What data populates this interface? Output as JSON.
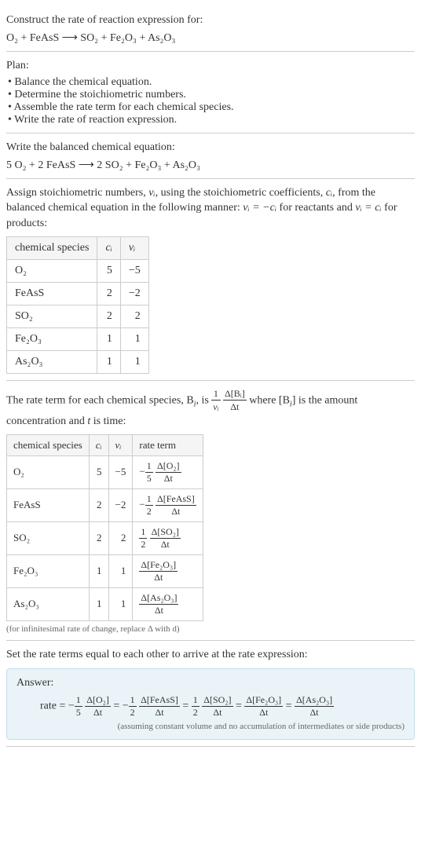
{
  "intro": {
    "title": "Construct the rate of reaction expression for:",
    "equation": "O₂ + FeAsS ⟶ SO₂ + Fe₂O₃ + As₂O₃"
  },
  "plan": {
    "heading": "Plan:",
    "items": [
      "Balance the chemical equation.",
      "Determine the stoichiometric numbers.",
      "Assemble the rate term for each chemical species.",
      "Write the rate of reaction expression."
    ]
  },
  "balanced": {
    "heading": "Write the balanced chemical equation:",
    "equation": "5 O₂ + 2 FeAsS ⟶ 2 SO₂ + Fe₂O₃ + As₂O₃"
  },
  "stoich": {
    "text_parts": {
      "p1": "Assign stoichiometric numbers, ",
      "nu_i": "νᵢ",
      "p2": ", using the stoichiometric coefficients, ",
      "c_i": "cᵢ",
      "p3": ", from the balanced chemical equation in the following manner: ",
      "eq1": "νᵢ = −cᵢ",
      "p4": " for reactants and ",
      "eq2": "νᵢ = cᵢ",
      "p5": " for products:"
    },
    "headers": {
      "species": "chemical species",
      "c": "cᵢ",
      "nu": "νᵢ"
    },
    "rows": [
      {
        "species": "O₂",
        "c": "5",
        "nu": "−5"
      },
      {
        "species": "FeAsS",
        "c": "2",
        "nu": "−2"
      },
      {
        "species": "SO₂",
        "c": "2",
        "nu": "2"
      },
      {
        "species": "Fe₂O₃",
        "c": "1",
        "nu": "1"
      },
      {
        "species": "As₂O₃",
        "c": "1",
        "nu": "1"
      }
    ]
  },
  "rate_term": {
    "text_parts": {
      "p1": "The rate term for each chemical species, B",
      "sub_i": "i",
      "p2": ", is ",
      "frac1_num": "1",
      "frac1_den": "νᵢ",
      "frac2_num": "Δ[Bᵢ]",
      "frac2_den": "Δt",
      "p3": " where [B",
      "p4": "] is the amount concentration and ",
      "t": "t",
      "p5": " is time:"
    },
    "headers": {
      "species": "chemical species",
      "c": "cᵢ",
      "nu": "νᵢ",
      "rate": "rate term"
    },
    "rows": [
      {
        "species": "O₂",
        "c": "5",
        "nu": "−5",
        "neg": "−",
        "fn1": "1",
        "fd1": "5",
        "fn2": "Δ[O₂]",
        "fd2": "Δt"
      },
      {
        "species": "FeAsS",
        "c": "2",
        "nu": "−2",
        "neg": "−",
        "fn1": "1",
        "fd1": "2",
        "fn2": "Δ[FeAsS]",
        "fd2": "Δt"
      },
      {
        "species": "SO₂",
        "c": "2",
        "nu": "2",
        "neg": "",
        "fn1": "1",
        "fd1": "2",
        "fn2": "Δ[SO₂]",
        "fd2": "Δt"
      },
      {
        "species": "Fe₂O₃",
        "c": "1",
        "nu": "1",
        "neg": "",
        "fn1": "",
        "fd1": "",
        "fn2": "Δ[Fe₂O₃]",
        "fd2": "Δt"
      },
      {
        "species": "As₂O₃",
        "c": "1",
        "nu": "1",
        "neg": "",
        "fn1": "",
        "fd1": "",
        "fn2": "Δ[As₂O₃]",
        "fd2": "Δt"
      }
    ],
    "caption": "(for infinitesimal rate of change, replace Δ with d)"
  },
  "final": {
    "heading": "Set the rate terms equal to each other to arrive at the rate expression:",
    "answer_label": "Answer:",
    "rate_label": "rate = ",
    "terms": [
      {
        "neg": "−",
        "fn1": "1",
        "fd1": "5",
        "fn2": "Δ[O₂]",
        "fd2": "Δt"
      },
      {
        "neg": "−",
        "fn1": "1",
        "fd1": "2",
        "fn2": "Δ[FeAsS]",
        "fd2": "Δt"
      },
      {
        "neg": "",
        "fn1": "1",
        "fd1": "2",
        "fn2": "Δ[SO₂]",
        "fd2": "Δt"
      },
      {
        "neg": "",
        "fn1": "",
        "fd1": "",
        "fn2": "Δ[Fe₂O₃]",
        "fd2": "Δt"
      },
      {
        "neg": "",
        "fn1": "",
        "fd1": "",
        "fn2": "Δ[As₂O₃]",
        "fd2": "Δt"
      }
    ],
    "eq": " = ",
    "caption": "(assuming constant volume and no accumulation of intermediates or side products)"
  }
}
